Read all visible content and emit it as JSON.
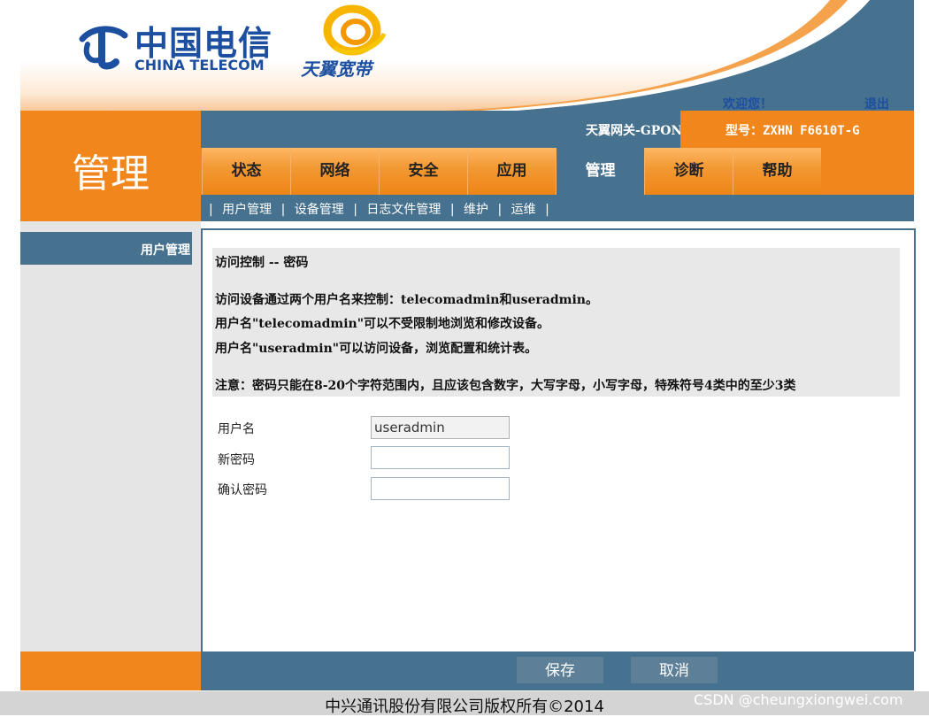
{
  "header": {
    "brand_cn": "中国电信",
    "brand_en": "CHINA TELECOM",
    "product": "天翼宽带",
    "welcome": "欢迎您！",
    "logout": "退出"
  },
  "section_title": "管理",
  "device": {
    "gateway": "天翼网关-GPON",
    "model": "型号：ZXHN F6610T-G"
  },
  "nav": {
    "tabs": [
      {
        "label": "状态"
      },
      {
        "label": "网络"
      },
      {
        "label": "安全"
      },
      {
        "label": "应用"
      },
      {
        "label": "管理",
        "active": true
      },
      {
        "label": "诊断"
      },
      {
        "label": "帮助"
      }
    ],
    "subtabs": [
      {
        "label": "用户管理"
      },
      {
        "label": "设备管理"
      },
      {
        "label": "日志文件管理"
      },
      {
        "label": "维护"
      },
      {
        "label": "运维"
      }
    ],
    "separator": "|"
  },
  "sidebar": {
    "items": [
      {
        "label": "用户管理"
      }
    ]
  },
  "content": {
    "heading": "访问控制 -- 密码",
    "lines": [
      "访问设备通过两个用户名来控制：telecomadmin和useradmin。",
      "用户名\"telecomadmin\"可以不受限制地浏览和修改设备。",
      "用户名\"useradmin\"可以访问设备，浏览配置和统计表。"
    ],
    "note": "注意：密码只能在8-20个字符范围内，且应该包含数字，大写字母，小写字母，特殊符号4类中的至少3类"
  },
  "form": {
    "username_label": "用户名",
    "username_value": "useradmin",
    "new_password_label": "新密码",
    "new_password_value": "",
    "confirm_password_label": "确认密码",
    "confirm_password_value": ""
  },
  "buttons": {
    "save": "保存",
    "cancel": "取消"
  },
  "footer": {
    "copyright": "中兴通讯股份有限公司版权所有©2014",
    "watermark": "CSDN @cheungxiongwei.com"
  },
  "colors": {
    "orange": "#f0861c",
    "steel_blue": "#46718f",
    "brand_blue": "#1d4fa0"
  }
}
